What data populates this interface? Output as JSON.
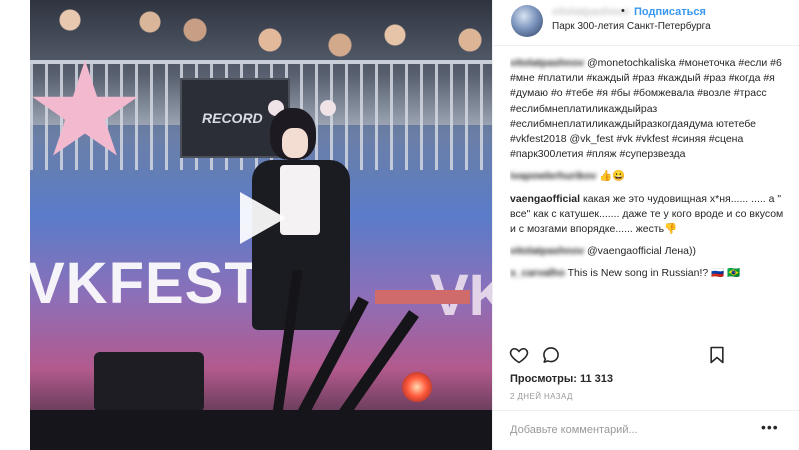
{
  "post": {
    "username": "vitolatpashnov",
    "dot": "•",
    "follow_label": "Подписаться",
    "location": "Парк 300-летия Санкт-Петербурга"
  },
  "media": {
    "banner_text": "RECORD",
    "stage_text_left": "VKFEST",
    "stage_text_right": "VK"
  },
  "comments": [
    {
      "user": "vitolatpashnov",
      "text": " @monetochkaliska #монеточка #если #6 #мне #платили #каждый #раз #каждый #раз #когда #я #думаю #о #тебе #я #бы #бомжевала #возле #трасс #еслибмнеплатиликаждыйраз #еслибмнеплатиликаждыйразкогдаядума ютетебе #vkfest2018 @vk_fest #vk #vkfest #синяя #сцена #парк300летия #пляж #суперзвезда"
    },
    {
      "user": "ivapowlerhurikov",
      "text": " 👍😀"
    },
    {
      "user": "vaengaofficial",
      "text": " какая же это чудовищная х*ня...... ..... а \" все\" как с катушек....... даже те у кого вроде и со вкусом и с мозгами впорядке...... жесть👎"
    },
    {
      "user": "vitolatpashnov",
      "text": " @vaengaofficial Лена))"
    },
    {
      "user": "s_carvalho",
      "text": " This is New song in Russian!? 🇷🇺 🇧🇷"
    }
  ],
  "likes": "Просмотры: 11 313",
  "timestamp": "2 ДНЕЙ НАЗАД",
  "add_comment": {
    "placeholder": "Добавьте комментарий...",
    "more": "•••"
  },
  "icons": [
    "heart-icon",
    "comment-icon",
    "bookmark-icon",
    "play-icon"
  ]
}
